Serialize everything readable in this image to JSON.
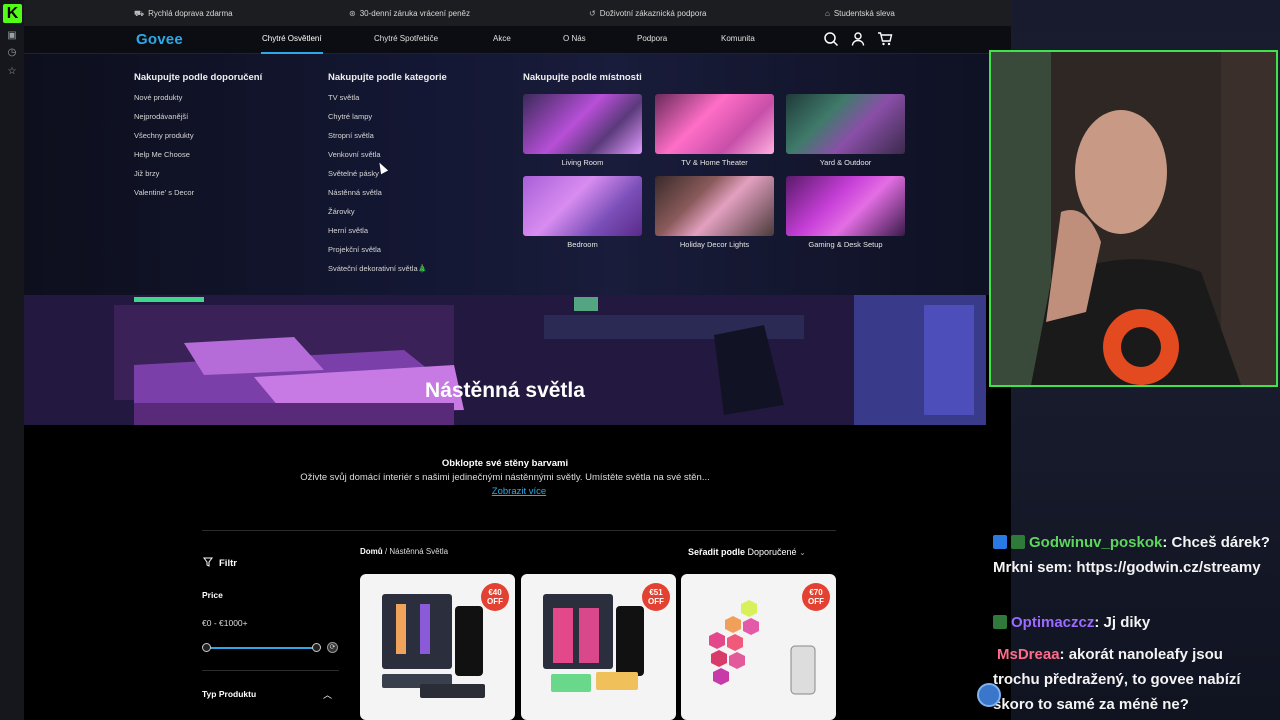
{
  "topbar": {
    "items": [
      {
        "icon": "truck-icon",
        "text": "Rychlá doprava zdarma"
      },
      {
        "icon": "money-back-icon",
        "text": "30-denní záruka vrácení peněz"
      },
      {
        "icon": "headset-icon",
        "text": "Doživotní zákaznická podpora"
      },
      {
        "icon": "graduation-cap-icon",
        "text": "Studentská sleva"
      }
    ]
  },
  "nav": {
    "logo": "Govee",
    "items": [
      "Chytré Osvětlení",
      "Chytré Spotřebiče",
      "Akce",
      "O Nás",
      "Podpora",
      "Komunita"
    ],
    "icons": [
      "search-icon",
      "user-icon",
      "cart-icon"
    ]
  },
  "mega": {
    "col1": {
      "title": "Nakupujte podle doporučení",
      "items": [
        "Nové produkty",
        "Nejprodávanější",
        "Všechny produkty",
        "Help Me Choose",
        "Již brzy",
        "Valentine' s Decor"
      ]
    },
    "col2": {
      "title": "Nakupujte podle kategorie",
      "items": [
        "TV světla",
        "Chytré lampy",
        "Stropní světla",
        "Venkovní světla",
        "Světelné pásky",
        "Nástěnná světla",
        "Žárovky",
        "Herní světla",
        "Projekční světla",
        "Sváteční dekorativní světla🎄"
      ]
    },
    "col3": {
      "title": "Nakupujte podle místnosti",
      "rooms": [
        "Living Room",
        "TV & Home Theater",
        "Yard & Outdoor",
        "Bedroom",
        "Holiday Decor Lights",
        "Gaming & Desk Setup"
      ]
    }
  },
  "hero": {
    "title": "Nástěnná světla"
  },
  "intro": {
    "heading": "Obklopte své stěny barvami",
    "text": "Oživte svůj domácí interiér s našimi jedinečnými nástěnnými světly. Umístěte světla na své stěn...",
    "more": "Zobrazit více"
  },
  "filter": {
    "label": "Filtr",
    "price_label": "Price",
    "price_range": "€0 - €1000+",
    "price_min": 0,
    "price_max": 1000,
    "type_label": "Typ Produktu"
  },
  "breadcrumb": {
    "home": "Domů",
    "sep": "/",
    "current": "Nástěnná Světla"
  },
  "sort": {
    "label": "Seřadit podle",
    "value": "Doporučené"
  },
  "products": [
    {
      "badge_top": "€40",
      "badge_bottom": "OFF"
    },
    {
      "badge_top": "€51",
      "badge_bottom": "OFF"
    },
    {
      "badge_top": "€70",
      "badge_bottom": "OFF"
    }
  ],
  "chat": [
    {
      "user": "Godwinuv_poskok",
      "color": "#5cd65c",
      "text": ": Chceš dárek? Mrkni sem: https://godwin.cz/streamy"
    },
    {
      "user": "Optimaczcz",
      "color": "#9b6bff",
      "text": ": Jj diky"
    },
    {
      "user": "MsDreaa",
      "color": "#ff6b8a",
      "text": ": akorát nanoleafy jsou trochu předražený, to govee nabízí skoro to samé za méně ne?"
    }
  ],
  "colors": {
    "accent": "#2ea8e6",
    "badge": "#e34233",
    "kick": "#53fc18"
  }
}
